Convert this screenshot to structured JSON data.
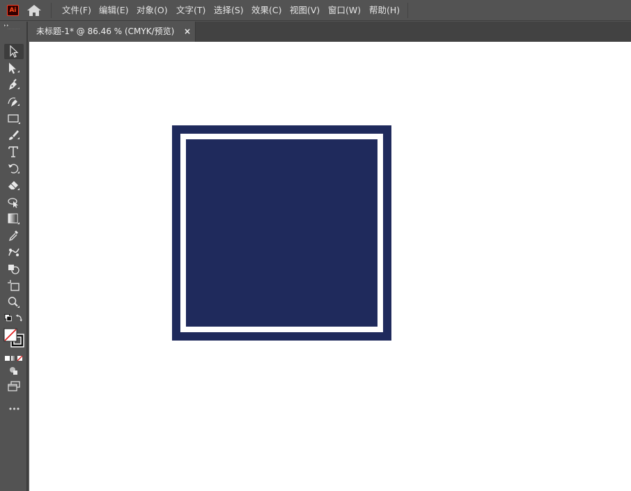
{
  "app": {
    "logo_text": "Ai",
    "logo_color": "#ff4a1c"
  },
  "menu": {
    "items": [
      {
        "label": "文件(F)"
      },
      {
        "label": "编辑(E)"
      },
      {
        "label": "对象(O)"
      },
      {
        "label": "文字(T)"
      },
      {
        "label": "选择(S)"
      },
      {
        "label": "效果(C)"
      },
      {
        "label": "视图(V)"
      },
      {
        "label": "窗口(W)"
      },
      {
        "label": "帮助(H)"
      }
    ]
  },
  "document": {
    "tab_label": "未标题-1* @ 86.46 % (CMYK/预览)",
    "close_glyph": "×",
    "zoom_percent": 86.46,
    "color_mode": "CMYK"
  },
  "toolbar": {
    "tools": [
      {
        "name": "selection-tool",
        "icon": "arrow-icon",
        "active": true
      },
      {
        "name": "direct-selection-tool",
        "icon": "direct-arrow-icon"
      },
      {
        "name": "pen-tool",
        "icon": "pen-icon"
      },
      {
        "name": "curvature-tool",
        "icon": "curvature-pen-icon"
      },
      {
        "name": "rectangle-tool",
        "icon": "rectangle-icon"
      },
      {
        "name": "paintbrush-tool",
        "icon": "brush-icon"
      },
      {
        "name": "type-tool",
        "icon": "type-icon"
      },
      {
        "name": "rotate-tool",
        "icon": "rotate-icon"
      },
      {
        "name": "eraser-tool",
        "icon": "eraser-icon"
      },
      {
        "name": "puppet-warp-tool",
        "icon": "puppet-warp-icon"
      },
      {
        "name": "gradient-tool",
        "icon": "gradient-icon"
      },
      {
        "name": "eyedropper-tool",
        "icon": "eyedropper-icon"
      },
      {
        "name": "blend-tool",
        "icon": "blend-icon"
      },
      {
        "name": "shape-builder-tool",
        "icon": "shape-builder-icon"
      },
      {
        "name": "artboard-tool",
        "icon": "artboard-icon"
      },
      {
        "name": "zoom-tool",
        "icon": "zoom-icon"
      }
    ],
    "more_label": "•••"
  },
  "artwork": {
    "fill_color": "#1f2a5c",
    "border_color": "#ffffff",
    "background_color": "#ffffff"
  }
}
